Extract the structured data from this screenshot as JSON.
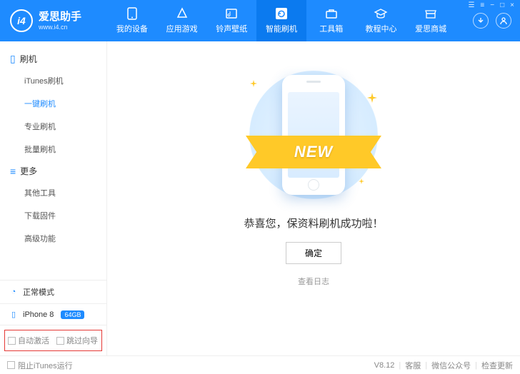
{
  "app": {
    "title": "爱思助手",
    "url": "www.i4.cn",
    "logo_text": "i4"
  },
  "win_controls": [
    "☰",
    "≡",
    "−",
    "□",
    "×"
  ],
  "nav": [
    {
      "label": "我的设备"
    },
    {
      "label": "应用游戏"
    },
    {
      "label": "铃声壁纸"
    },
    {
      "label": "智能刷机",
      "active": true
    },
    {
      "label": "工具箱"
    },
    {
      "label": "教程中心"
    },
    {
      "label": "爱思商城"
    }
  ],
  "sidebar": {
    "groups": [
      {
        "title": "刷机",
        "items": [
          {
            "label": "iTunes刷机"
          },
          {
            "label": "一键刷机",
            "active": true
          },
          {
            "label": "专业刷机"
          },
          {
            "label": "批量刷机"
          }
        ]
      },
      {
        "title": "更多",
        "items": [
          {
            "label": "其他工具"
          },
          {
            "label": "下载固件"
          },
          {
            "label": "高级功能"
          }
        ]
      }
    ],
    "mode": "正常模式",
    "device": {
      "name": "iPhone 8",
      "storage": "64GB"
    },
    "checks": {
      "auto_activate": "自动激活",
      "skip_guide": "跳过向导"
    }
  },
  "main": {
    "ribbon": "NEW",
    "message": "恭喜您，保资料刷机成功啦！",
    "confirm": "确定",
    "view_log": "查看日志"
  },
  "footer": {
    "block_itunes": "阻止iTunes运行",
    "version": "V8.12",
    "service": "客服",
    "wechat": "微信公众号",
    "check_update": "检查更新"
  }
}
